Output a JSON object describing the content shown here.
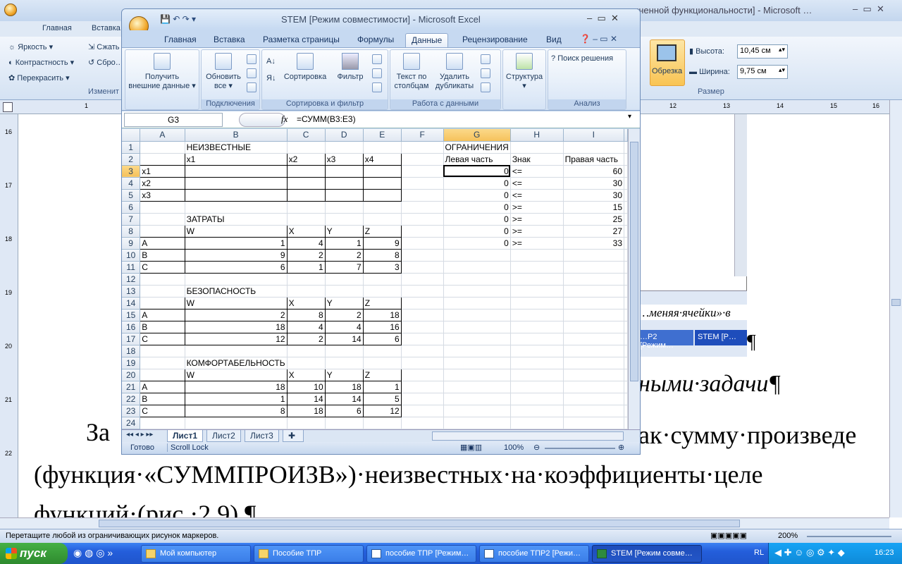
{
  "word": {
    "title": "…граниченной функциональности] - Microsoft …",
    "tabs": [
      "Главная",
      "Вставка"
    ],
    "ribbon_items": [
      "Яркость",
      "Контрастность",
      "Перекрасить",
      "Сжать",
      "Сбро…"
    ],
    "group_label": "Изменит",
    "size_group": {
      "crop_label": "Обрезка",
      "height_label": "Высота:",
      "height_value": "10,45 см",
      "width_label": "Ширина:",
      "width_value": "9,75 см",
      "label": "Размер"
    },
    "ruler_numbers": [
      "1",
      "12",
      "13",
      "14",
      "15",
      "16"
    ],
    "vruler_numbers": [
      "16",
      "17",
      "18",
      "19",
      "20",
      "21",
      "22"
    ],
    "body_italic_1": "…меняя·ячейки»·в",
    "body_italic_2": "ными·задачи¶",
    "body_line_1_prefix": "За",
    "body_line_1_suffix": "ак·сумму·произведе",
    "body_line_2": "(функция·«СУММПРОИЗВ»)·неизвестных·на·коэффициенты·целе",
    "body_line_3": "функций·(рис.·2.9).¶",
    "embedded_tasks": [
      "…Р2 [Режим…",
      "STEM [Р…"
    ],
    "pilcrow": "¶",
    "status_text": "Перетащите любой из ограничивающих рисунок маркеров.",
    "zoom": "200%"
  },
  "excel": {
    "title": "STEM  [Режим совместимости] - Microsoft Excel",
    "tabs": [
      "Главная",
      "Вставка",
      "Разметка страницы",
      "Формулы",
      "Данные",
      "Рецензирование",
      "Вид"
    ],
    "active_tab": "Данные",
    "ribbon": {
      "get_external": "Получить внешние данные",
      "refresh_all": "Обновить все",
      "connections": "Подключения",
      "sort": "Сортировка",
      "filter": "Фильтр",
      "sort_filter": "Сортировка и фильтр",
      "text_to_columns": "Текст по столбцам",
      "remove_duplicates": "Удалить дубликаты",
      "data_tools": "Работа с данными",
      "outline": "Структура",
      "solver": "Поиск решения",
      "analysis": "Анализ"
    },
    "name_box": "G3",
    "fx": "fx",
    "formula": "=СУММ(B3:E3)",
    "columns": [
      "A",
      "B",
      "C",
      "D",
      "E",
      "F",
      "G",
      "H",
      "I"
    ],
    "rows": [
      [
        "",
        "НЕИЗВЕСТНЫЕ",
        "",
        "",
        "",
        "",
        "ОГРАНИЧЕНИЯ",
        "",
        ""
      ],
      [
        "",
        "x1",
        "x2",
        "x3",
        "x4",
        "",
        "Левая часть",
        "Знак",
        "Правая часть"
      ],
      [
        "x1",
        "",
        "",
        "",
        "",
        "",
        "0",
        "<=",
        "60"
      ],
      [
        "x2",
        "",
        "",
        "",
        "",
        "",
        "0",
        "<=",
        "30"
      ],
      [
        "x3",
        "",
        "",
        "",
        "",
        "",
        "0",
        "<=",
        "30"
      ],
      [
        "",
        "",
        "",
        "",
        "",
        "",
        "0",
        ">=",
        "15"
      ],
      [
        "",
        "ЗАТРАТЫ",
        "",
        "",
        "",
        "",
        "0",
        ">=",
        "25"
      ],
      [
        "",
        "W",
        "X",
        "Y",
        "Z",
        "",
        "0",
        ">=",
        "27"
      ],
      [
        "A",
        "1",
        "4",
        "1",
        "9",
        "",
        "0",
        ">=",
        "33"
      ],
      [
        "B",
        "9",
        "2",
        "2",
        "8",
        "",
        "",
        "",
        ""
      ],
      [
        "C",
        "6",
        "1",
        "7",
        "3",
        "",
        "",
        "",
        ""
      ],
      [
        "",
        "",
        "",
        "",
        "",
        "",
        "",
        "",
        ""
      ],
      [
        "",
        "БЕЗОПАСНОСТЬ",
        "",
        "",
        "",
        "",
        "",
        "",
        ""
      ],
      [
        "",
        "W",
        "X",
        "Y",
        "Z",
        "",
        "",
        "",
        ""
      ],
      [
        "A",
        "2",
        "8",
        "2",
        "18",
        "",
        "",
        "",
        ""
      ],
      [
        "B",
        "18",
        "4",
        "4",
        "16",
        "",
        "",
        "",
        ""
      ],
      [
        "C",
        "12",
        "2",
        "14",
        "6",
        "",
        "",
        "",
        ""
      ],
      [
        "",
        "",
        "",
        "",
        "",
        "",
        "",
        "",
        ""
      ],
      [
        "",
        "КОМФОРТАБЕЛЬНОСТЬ",
        "",
        "",
        "",
        "",
        "",
        "",
        ""
      ],
      [
        "",
        "W",
        "X",
        "Y",
        "Z",
        "",
        "",
        "",
        ""
      ],
      [
        "A",
        "18",
        "10",
        "18",
        "1",
        "",
        "",
        "",
        ""
      ],
      [
        "B",
        "1",
        "14",
        "14",
        "5",
        "",
        "",
        "",
        ""
      ],
      [
        "C",
        "8",
        "18",
        "6",
        "12",
        "",
        "",
        "",
        ""
      ],
      [
        "",
        "",
        "",
        "",
        "",
        "",
        "",
        "",
        ""
      ]
    ],
    "sheets": [
      "Лист1",
      "Лист2",
      "Лист3"
    ],
    "status_ready": "Готово",
    "status_scroll": "Scroll Lock",
    "zoom": "100%"
  },
  "taskbar": {
    "start": "пуск",
    "items": [
      "Мой компьютер",
      "Пособие ТПР",
      "пособие ТПР [Режим…",
      "пособие ТПР2 [Режи…",
      "STEM  [Режим совме…"
    ],
    "lang": "RL",
    "time": "16:23"
  }
}
